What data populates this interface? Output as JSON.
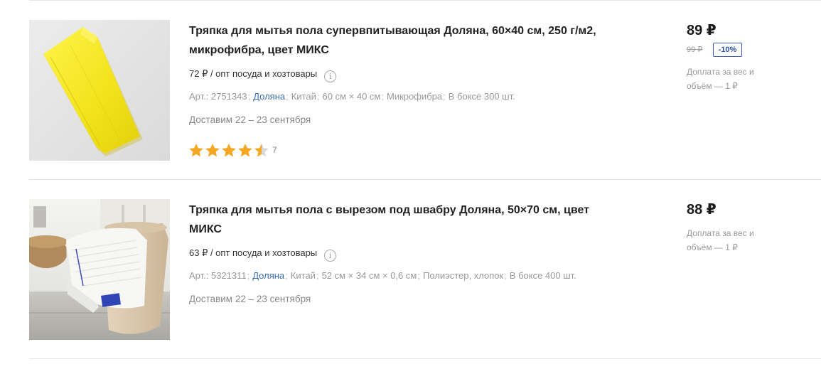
{
  "products": [
    {
      "title": "Тряпка для мытья пола супервпитывающая Доляна, 60×40 см, 250 г/м2, микрофибра, цвет МИКС",
      "wholesale_price": "72 ₽ / опт посуда и хозтовары",
      "specs": {
        "article": "Арт.: 2751343",
        "brand": "Доляна",
        "country": "Китай",
        "size": "60 см × 40 см",
        "material": "Микрофибра",
        "box": "В боксе 300 шт."
      },
      "delivery": "Доставим 22 – 23 сентября",
      "rating": 4.5,
      "rating_count": "7",
      "price": "89 ₽",
      "old_price": "99 ₽",
      "discount": "-10%",
      "surcharge": "Доплата за вес и объём — 1 ₽",
      "image_icon": "yellow-cloth-photo"
    },
    {
      "title": "Тряпка для мытья пола с вырезом под швабру Доляна, 50×70 см, цвет МИКС",
      "wholesale_price": "63 ₽ / опт посуда и хозтовары",
      "specs": {
        "article": "Арт.: 5321311",
        "brand": "Доляна",
        "country": "Китай",
        "size": "52 см × 34 см × 0,6 см",
        "material": "Полиэстер, хлопок",
        "box": "В боксе 400 шт."
      },
      "delivery": "Доставим 22 – 23 сентября",
      "price": "88 ₽",
      "surcharge": "Доплата за вес и объём — 1 ₽",
      "image_icon": "white-cloth-bucket-photo"
    }
  ],
  "colors": {
    "star": "#f5a623",
    "brand_link": "#3b6fb6",
    "discount_border": "#3f5fbf"
  }
}
